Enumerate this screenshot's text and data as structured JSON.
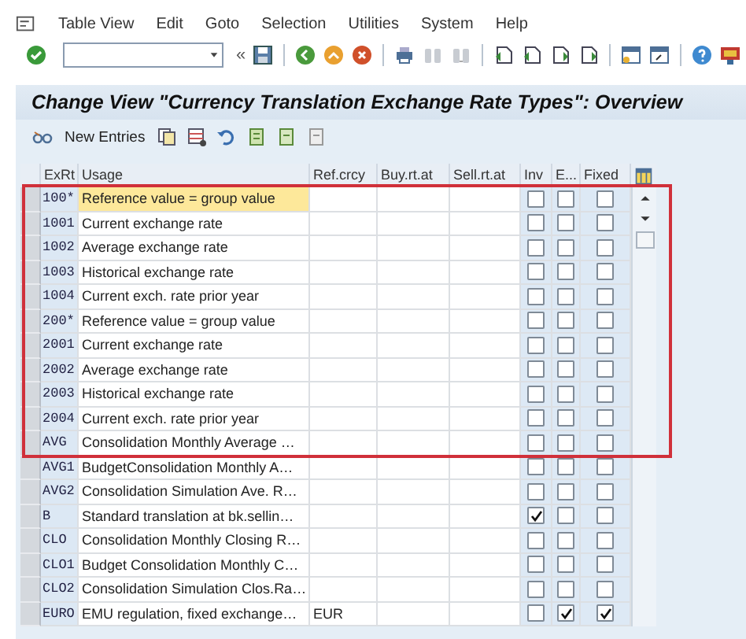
{
  "menu": [
    "Table View",
    "Edit",
    "Goto",
    "Selection",
    "Utilities",
    "System",
    "Help"
  ],
  "title": "Change View \"Currency Translation Exchange Rate Types\": Overview",
  "command_scroll": "«",
  "app_toolbar": {
    "new_entries": "New Entries"
  },
  "table": {
    "columns": [
      "ExRt",
      "Usage",
      "Ref.crcy",
      "Buy.rt.at",
      "Sell.rt.at",
      "Inv",
      "E...",
      "Fixed"
    ],
    "rows": [
      {
        "code": "100*",
        "usage": "Reference value = group value",
        "ref_crcy": "",
        "inv": false,
        "e": false,
        "fixed": false,
        "focused": true
      },
      {
        "code": "1001",
        "usage": "Current exchange rate",
        "ref_crcy": "",
        "inv": false,
        "e": false,
        "fixed": false,
        "focused": false
      },
      {
        "code": "1002",
        "usage": "Average exchange rate",
        "ref_crcy": "",
        "inv": false,
        "e": false,
        "fixed": false,
        "focused": false
      },
      {
        "code": "1003",
        "usage": "Historical exchange rate",
        "ref_crcy": "",
        "inv": false,
        "e": false,
        "fixed": false,
        "focused": false
      },
      {
        "code": "1004",
        "usage": "Current exch. rate prior year",
        "ref_crcy": "",
        "inv": false,
        "e": false,
        "fixed": false,
        "focused": false
      },
      {
        "code": "200*",
        "usage": "Reference value = group value",
        "ref_crcy": "",
        "inv": false,
        "e": false,
        "fixed": false,
        "focused": false
      },
      {
        "code": "2001",
        "usage": "Current exchange rate",
        "ref_crcy": "",
        "inv": false,
        "e": false,
        "fixed": false,
        "focused": false
      },
      {
        "code": "2002",
        "usage": "Average exchange rate",
        "ref_crcy": "",
        "inv": false,
        "e": false,
        "fixed": false,
        "focused": false
      },
      {
        "code": "2003",
        "usage": "Historical exchange rate",
        "ref_crcy": "",
        "inv": false,
        "e": false,
        "fixed": false,
        "focused": false
      },
      {
        "code": "2004",
        "usage": "Current exch. rate prior year",
        "ref_crcy": "",
        "inv": false,
        "e": false,
        "fixed": false,
        "focused": false
      },
      {
        "code": "AVG",
        "usage": "Consolidation Monthly Average …",
        "ref_crcy": "",
        "inv": false,
        "e": false,
        "fixed": false,
        "focused": false
      },
      {
        "code": "AVG1",
        "usage": "BudgetConsolidation Monthly A…",
        "ref_crcy": "",
        "inv": false,
        "e": false,
        "fixed": false,
        "focused": false
      },
      {
        "code": "AVG2",
        "usage": "Consolidation Simulation Ave. R…",
        "ref_crcy": "",
        "inv": false,
        "e": false,
        "fixed": false,
        "focused": false
      },
      {
        "code": "B",
        "usage": "Standard translation at bk.sellin…",
        "ref_crcy": "",
        "inv": true,
        "e": false,
        "fixed": false,
        "focused": false
      },
      {
        "code": "CLO",
        "usage": "Consolidation Monthly Closing R…",
        "ref_crcy": "",
        "inv": false,
        "e": false,
        "fixed": false,
        "focused": false
      },
      {
        "code": "CLO1",
        "usage": "Budget Consolidation Monthly C…",
        "ref_crcy": "",
        "inv": false,
        "e": false,
        "fixed": false,
        "focused": false
      },
      {
        "code": "CLO2",
        "usage": "Consolidation Simulation Clos.Ra…",
        "ref_crcy": "",
        "inv": false,
        "e": false,
        "fixed": false,
        "focused": false
      },
      {
        "code": "EURO",
        "usage": "EMU regulation, fixed exchange…",
        "ref_crcy": "EUR",
        "inv": false,
        "e": true,
        "fixed": true,
        "focused": false
      }
    ]
  }
}
